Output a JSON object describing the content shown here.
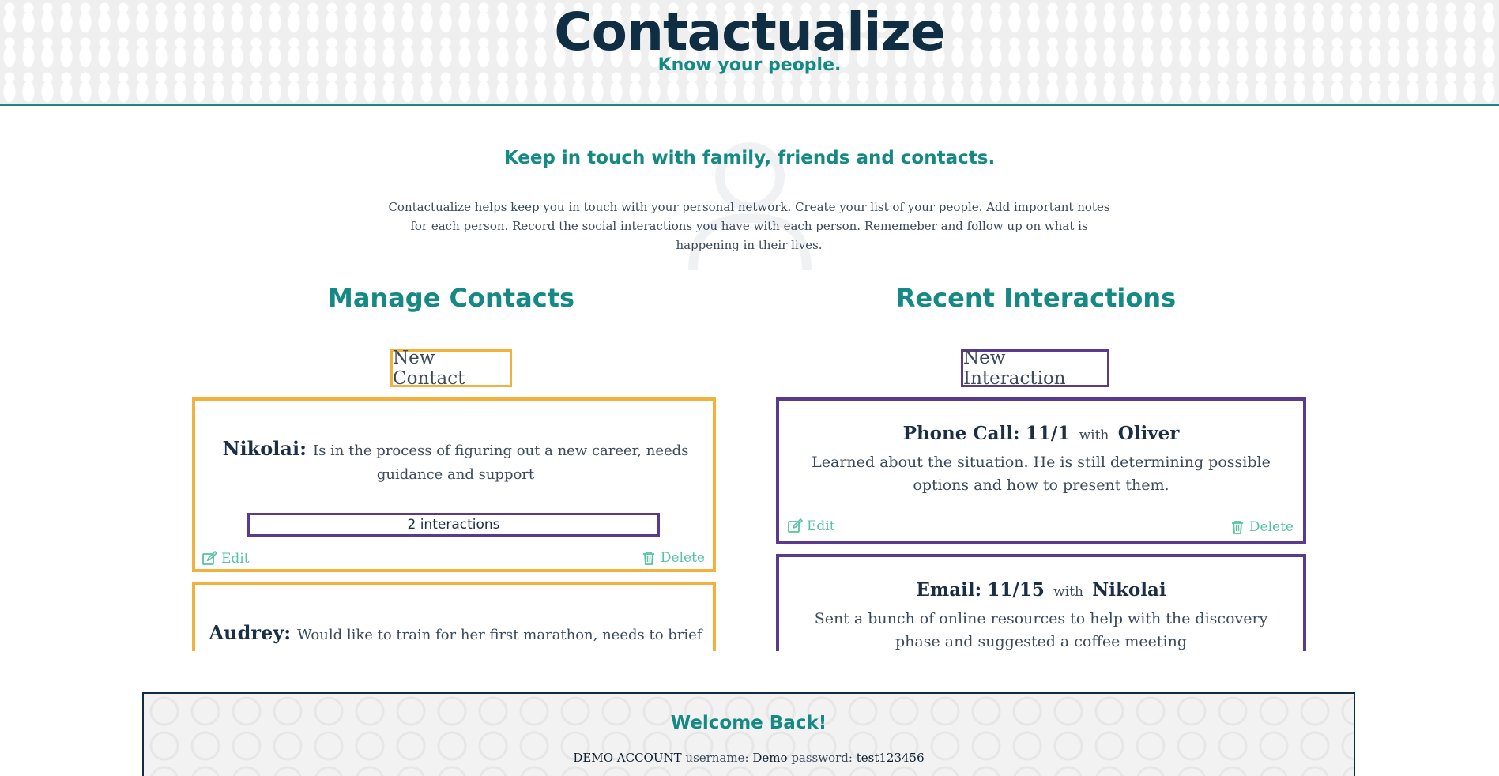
{
  "header": {
    "brand": "Contactualize",
    "tagline": "Know your people."
  },
  "intro": {
    "heading": "Keep in touch with family, friends and contacts.",
    "text": "Contactualize helps keep you in touch with your personal network. Create your list of your people. Add important notes for each person. Record the social interactions you have with each person. Rememeber and follow up on what is happening in their lives."
  },
  "contacts": {
    "heading": "Manage Contacts",
    "new_button": "New Contact",
    "items": [
      {
        "name": "Nikolai:",
        "note": "Is in the process of figuring out a new career, needs guidance and support",
        "interactions_label": "2 interactions",
        "edit": "Edit",
        "delete": "Delete"
      },
      {
        "name": "Audrey:",
        "note": "Would like to train for her first marathon, needs to brief check ins"
      }
    ]
  },
  "interactions": {
    "heading": "Recent Interactions",
    "new_button": "New Interaction",
    "items": [
      {
        "type": "Phone Call:",
        "date": "11/1",
        "with": "with",
        "person": "Oliver",
        "notes": "Learned about the situation. He is still determining possible options and how to present them.",
        "edit": "Edit",
        "delete": "Delete"
      },
      {
        "type": "Email:",
        "date": "11/15",
        "with": "with",
        "person": "Nikolai",
        "notes": "Sent a bunch of online resources to help with the discovery phase and suggested a coffee meeting"
      }
    ]
  },
  "welcome": {
    "title": "Welcome Back!",
    "demo_account": "DEMO ACCOUNT",
    "username_label": "username:",
    "username": "Demo",
    "password_label": "password:",
    "password": "test123456"
  },
  "colors": {
    "brand_navy": "#0f2e44",
    "teal": "#158984",
    "contact_accent": "#f1b13c",
    "interaction_accent": "#5a3a8c",
    "action_green": "#55c3a4"
  },
  "icons": {
    "edit": "pencil-square-icon",
    "delete": "trash-icon",
    "watermark": "person-icon"
  }
}
